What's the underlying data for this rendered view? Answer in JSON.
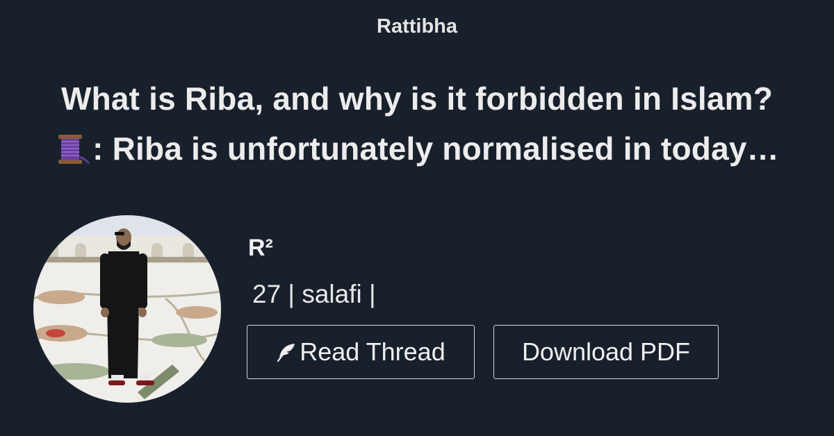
{
  "site": {
    "title": "Rattibha"
  },
  "thread": {
    "title_line1": "What is Riba, and why is it forbidden in Islam?",
    "title_line2": ": Riba is unfortunately normalised in today…",
    "emoji_icon": "spool-of-thread-icon"
  },
  "author": {
    "name": "R²",
    "bio": "27 | salafi |"
  },
  "actions": {
    "read_label": "Read Thread",
    "read_icon": "feather-icon",
    "pdf_label": "Download PDF"
  },
  "colors": {
    "background": "#18202c",
    "text": "#ebebeb",
    "button_border": "#d8d8d8"
  }
}
